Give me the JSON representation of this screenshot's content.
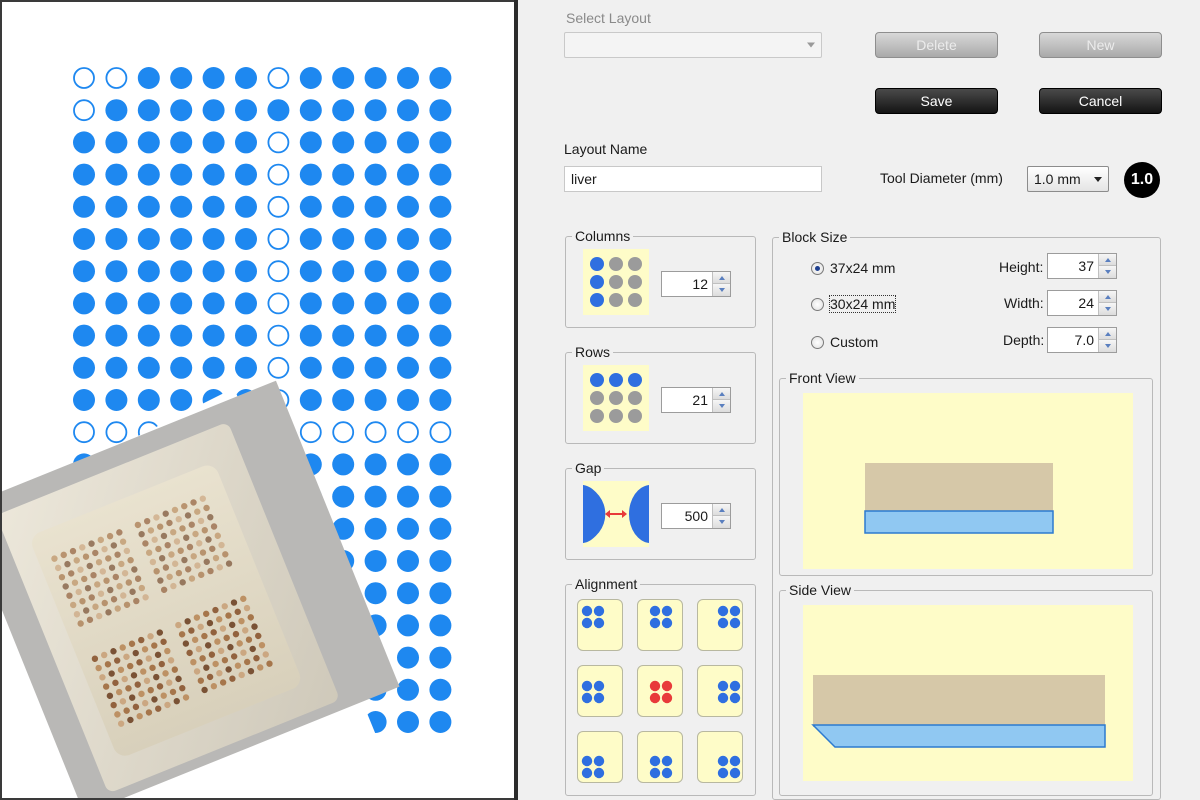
{
  "colors": {
    "dot_blue": "#1e88f0",
    "highlight_red": "#e83a3a",
    "thumb_bg": "#fefcc8",
    "block_tan": "#d6c8a8",
    "slide_blue": "#90c8f2",
    "slide_edge": "#2c7ad0",
    "gray_dot": "#9b9b9b"
  },
  "array_preview": {
    "columns": 12,
    "rows": 21,
    "empty_cells": [
      [
        0,
        0
      ],
      [
        0,
        1
      ],
      [
        0,
        6
      ],
      [
        1,
        0
      ],
      [
        2,
        6
      ],
      [
        3,
        6
      ],
      [
        4,
        6
      ],
      [
        5,
        6
      ],
      [
        6,
        6
      ],
      [
        7,
        6
      ],
      [
        8,
        6
      ],
      [
        9,
        6
      ],
      [
        10,
        6
      ],
      [
        11,
        0
      ],
      [
        11,
        1
      ],
      [
        11,
        2
      ],
      [
        11,
        3
      ],
      [
        11,
        4
      ],
      [
        11,
        5
      ],
      [
        11,
        6
      ],
      [
        11,
        7
      ],
      [
        11,
        8
      ],
      [
        11,
        9
      ],
      [
        11,
        10
      ],
      [
        11,
        11
      ]
    ]
  },
  "dialog": {
    "select_layout_label": "Select Layout",
    "select_layout_value": "",
    "delete_label": "Delete",
    "new_label": "New",
    "save_label": "Save",
    "cancel_label": "Cancel",
    "layout_name_label": "Layout Name",
    "layout_name_value": "liver",
    "tool_diameter_label": "Tool Diameter (mm)",
    "tool_diameter_value": "1.0 mm",
    "tool_badge": "1.0",
    "columns_title": "Columns",
    "columns_value": "12",
    "rows_title": "Rows",
    "rows_value": "21",
    "gap_title": "Gap",
    "gap_value": "500",
    "alignment_title": "Alignment",
    "alignment_selected": "center",
    "block_size_title": "Block Size",
    "block_options": [
      "37x24 mm",
      "30x24 mm",
      "Custom"
    ],
    "block_selected": "37x24 mm",
    "height_label": "Height:",
    "height_value": "37",
    "width_label": "Width:",
    "width_value": "24",
    "depth_label": "Depth:",
    "depth_value": "7.0",
    "front_view_title": "Front View",
    "side_view_title": "Side View"
  }
}
